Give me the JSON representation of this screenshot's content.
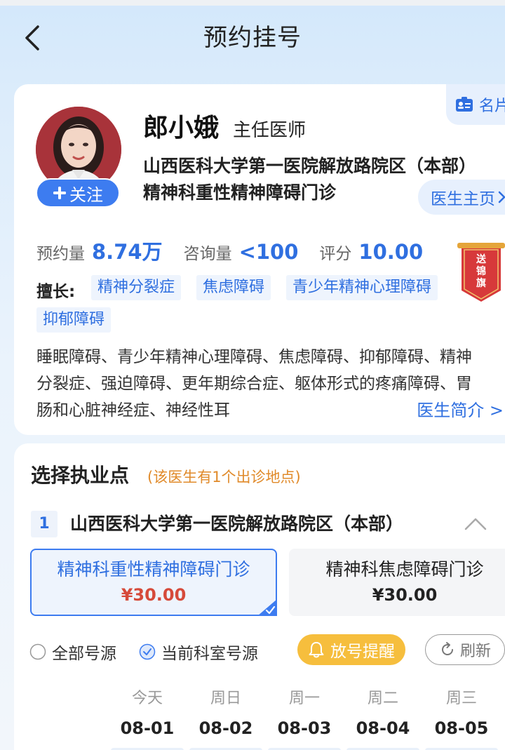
{
  "header": {
    "title": "预约挂号"
  },
  "doctor": {
    "name": "郎小娥",
    "title": "主任医师",
    "hospital": "山西医科大学第一医院解放路院区（本部） 精神科重性精神障碍门诊",
    "follow_label": "关注",
    "namecard_label": "名片",
    "home_label": "医生主页",
    "flag_badge_text": "送锦旗",
    "stats": [
      {
        "label": "预约量",
        "value": "8.74万"
      },
      {
        "label": "咨询量",
        "value": "<100"
      },
      {
        "label": "评分",
        "value": "10.00"
      }
    ],
    "skills_label": "擅长:",
    "skill_tags": [
      "精神分裂症",
      "焦虑障碍",
      "青少年精神心理障碍",
      "抑郁障碍"
    ],
    "intro_text": "睡眠障碍、青少年精神心理障碍、焦虑障碍、抑郁障碍、精神分裂症、强迫障碍、更年期综合症、躯体形式的疼痛障碍、胃肠和心脏神经症、神经性耳",
    "intro_link": "医生简介 >"
  },
  "location": {
    "title": "选择执业点",
    "note": "(该医生有1个出诊地点)",
    "site_number": "1",
    "site_name": "山西医科大学第一医院解放路院区（本部）",
    "departments": [
      {
        "name": "精神科重性精神障碍门诊",
        "price": "¥30.00",
        "selected": true
      },
      {
        "name": "精神科焦虑障碍门诊",
        "price": "¥30.00",
        "selected": false
      }
    ],
    "filters": {
      "all_sources": "全部号源",
      "current_dept": "当前科室号源",
      "current_dept_checked": true,
      "remind_label": "放号提醒",
      "refresh_label": "刷新"
    },
    "days": [
      {
        "week": "今天",
        "date": "08-01"
      },
      {
        "week": "周日",
        "date": "08-02"
      },
      {
        "week": "周一",
        "date": "08-03"
      },
      {
        "week": "周二",
        "date": "08-04"
      },
      {
        "week": "周三",
        "date": "08-05"
      }
    ]
  },
  "colors": {
    "accent": "#2f6fe0",
    "price_red": "#d64a3a",
    "orange": "#e08a2a",
    "remind_yellow": "#f6be3d"
  }
}
